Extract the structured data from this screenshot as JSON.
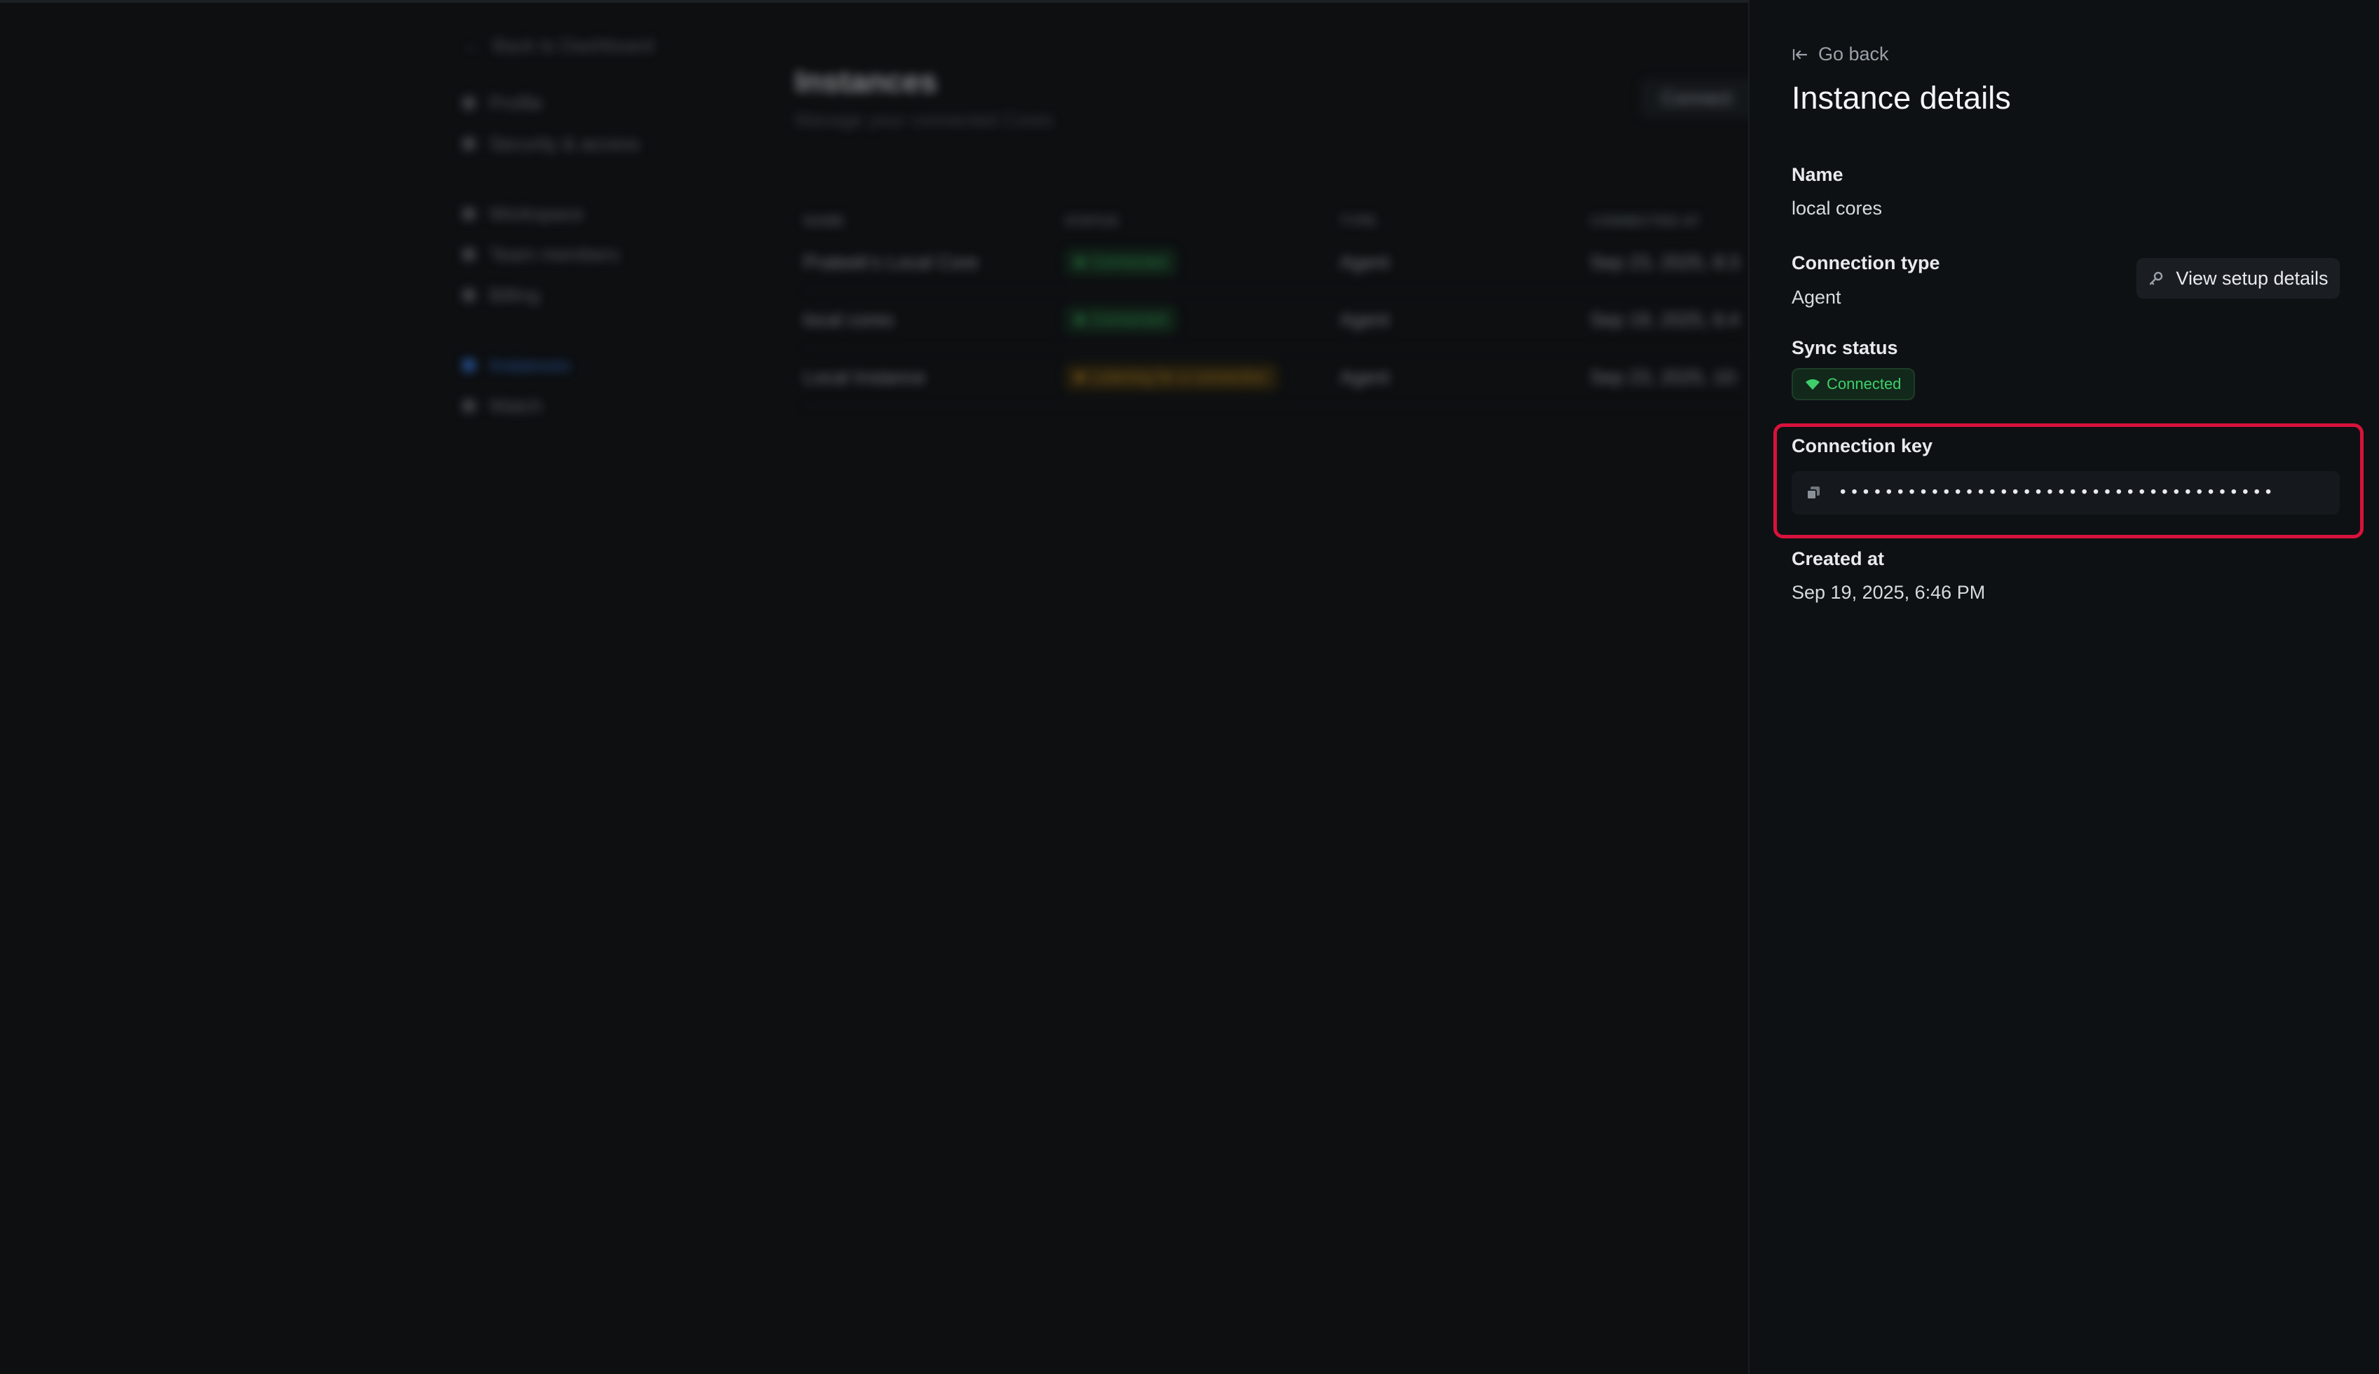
{
  "background": {
    "sidebar": {
      "back_label": "Back to Dashboard",
      "groups": [
        [
          {
            "label": "Profile"
          },
          {
            "label": "Security & access"
          }
        ],
        [
          {
            "label": "Workspace"
          },
          {
            "label": "Team members"
          },
          {
            "label": "Billing"
          }
        ],
        [
          {
            "label": "Instances",
            "active": true
          },
          {
            "label": "Watch"
          }
        ]
      ]
    },
    "main": {
      "title": "Instances",
      "subtitle": "Manage your connected Cores",
      "connect_label": "Connect",
      "columns": [
        "NAME",
        "STATUS",
        "TYPE",
        "CONNECTED AT"
      ],
      "rows": [
        {
          "name": "Prateek's Local Core",
          "status": "Connected",
          "status_color": "green",
          "type": "Agent",
          "connected_at": "Sep 23, 2025, 8:3"
        },
        {
          "name": "local cores",
          "status": "Connected",
          "status_color": "green",
          "type": "Agent",
          "connected_at": "Sep 19, 2025, 6:4"
        },
        {
          "name": "Local Instance",
          "status": "Listening for a connection",
          "status_color": "amber",
          "type": "Agent",
          "connected_at": "Sep 23, 2025, 10:"
        }
      ]
    }
  },
  "panel": {
    "go_back": "Go back",
    "title": "Instance details",
    "name_label": "Name",
    "name_value": "local cores",
    "connection_type_label": "Connection type",
    "connection_type_value": "Agent",
    "setup_button": "View setup details",
    "sync_status_label": "Sync status",
    "sync_status_value": "Connected",
    "connection_key_label": "Connection key",
    "connection_key_value": "••••••••••••••••••••••••••••••••••••••",
    "created_at_label": "Created at",
    "created_at_value": "Sep 19, 2025, 6:46 PM"
  },
  "colors": {
    "highlight": "#d8123c",
    "connected": "#3ecf6b",
    "accent": "#3b82f6"
  }
}
